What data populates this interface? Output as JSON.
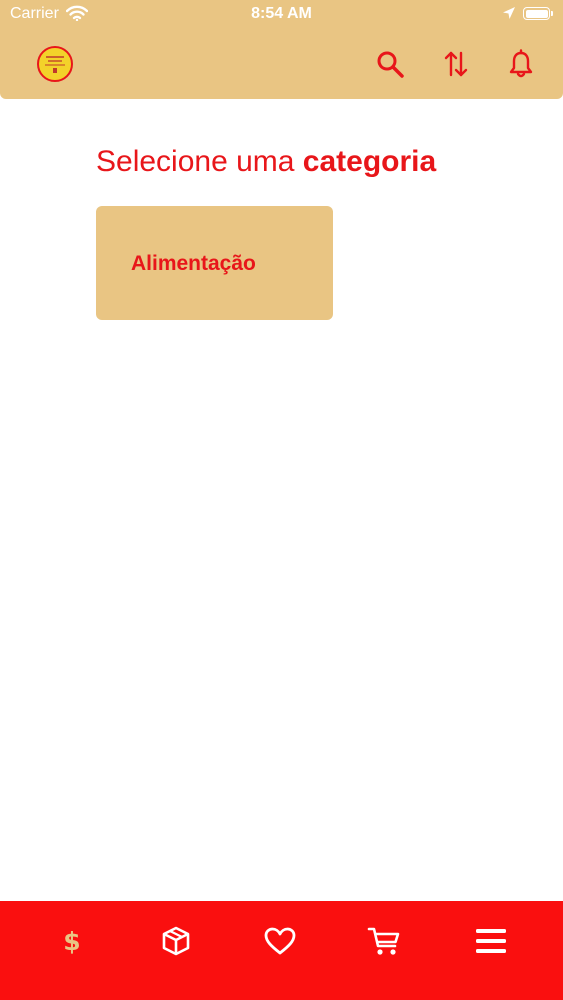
{
  "status_bar": {
    "carrier": "Carrier",
    "time": "8:54 AM",
    "icons": [
      "wifi-icon",
      "location-arrow-icon",
      "battery-icon"
    ]
  },
  "header": {
    "logo": "store-logo",
    "actions": [
      {
        "name": "search",
        "icon": "search-icon"
      },
      {
        "name": "sort",
        "icon": "sort-icon"
      },
      {
        "name": "notifications",
        "icon": "bell-icon"
      }
    ]
  },
  "main": {
    "title_prefix": "Selecione uma ",
    "title_emphasis": "categoria",
    "categories": [
      {
        "label": "Alimentação"
      }
    ]
  },
  "bottom_nav": {
    "items": [
      {
        "name": "finance",
        "icon": "dollar-icon",
        "glyph": "$",
        "active": true
      },
      {
        "name": "orders",
        "icon": "package-icon"
      },
      {
        "name": "favorites",
        "icon": "heart-icon"
      },
      {
        "name": "cart",
        "icon": "cart-icon"
      },
      {
        "name": "menu",
        "icon": "menu-icon"
      }
    ]
  },
  "colors": {
    "primary_red": "#e8161a",
    "nav_red": "#fa0f0f",
    "accent_tan": "#e9c583",
    "background": "#ffffff"
  }
}
